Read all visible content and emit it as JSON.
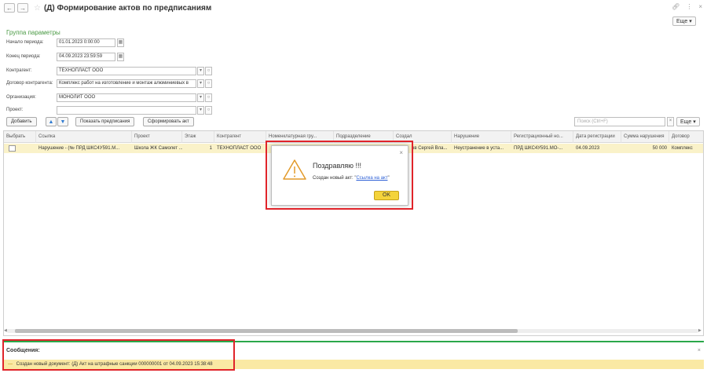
{
  "window": {
    "title": "(Д) Формирование актов по предписаниям",
    "back_icon": "arrow-left-icon",
    "forward_icon": "arrow-right-icon",
    "favorite_icon": "star-icon",
    "link_icon": "link-icon",
    "menu_icon": "more-vertical-icon",
    "close_icon": "close-icon"
  },
  "header": {
    "more_label": "Еще"
  },
  "params": {
    "group_title": "Группа параметры",
    "period_start": {
      "label": "Начало периода:",
      "value": "01.01.2023  0:00:00"
    },
    "period_end": {
      "label": "Конец периода:",
      "value": "04.09.2023 23:59:59"
    },
    "counterparty": {
      "label": "Контрагент:",
      "value": "ТЕХНОПЛАСТ ООО"
    },
    "contract": {
      "label": "Договор контрагента:",
      "value": "Комплекс  работ на изготовление и монтаж алюминиевых в"
    },
    "organization": {
      "label": "Организация:",
      "value": "МОНОЛИТ ООО"
    },
    "project": {
      "label": "Проект:",
      "value": ""
    }
  },
  "toolbar": {
    "add_label": "Добавить",
    "show_label": "Показать предписания",
    "form_label": "Сформировать акт",
    "search_placeholder": "Поиск (Ctrl+F)",
    "more_label": "Еще"
  },
  "table": {
    "columns": [
      "Выбрать",
      "Ссылка",
      "Проект",
      "Этаж",
      "Контрагент",
      "Номенклатурная гру...",
      "Подразделение",
      "Создал",
      "Нарушение",
      "Регистрационный но...",
      "Дата регистрации",
      "Сумма нарушения",
      "Договор"
    ],
    "row": {
      "link": "Нарушение - (№ ПРД ШКС4У591.М...",
      "project": "Школа ЖК Самолет ...",
      "floor": "1",
      "counterparty": "ТЕХНОПЛАСТ ООО",
      "creator": "ов Сергей Вла...",
      "violation": "Неустранение в уста...",
      "reg_number": "ПРД ШКС4У591.МО-...",
      "reg_date": "04.09.2023",
      "amount": "50 000",
      "contract": "Комплекс"
    }
  },
  "dialog": {
    "title": "Поздравляю !!!",
    "text": "Создан новый акт: \"",
    "link": "Ссылка на акт",
    "text_end": "\"",
    "ok_label": "OK"
  },
  "messages": {
    "title": "Сообщения:",
    "items": [
      "Создан новый документ: (Д) Акт на штрафные санкции 000000001 от 04.09.2023 15:38:48"
    ]
  },
  "colors": {
    "accent_green": "#4a9a44",
    "selection_row": "#faf2c9",
    "ok_button": "#f4d33b",
    "annotation_red": "#e0242a"
  }
}
